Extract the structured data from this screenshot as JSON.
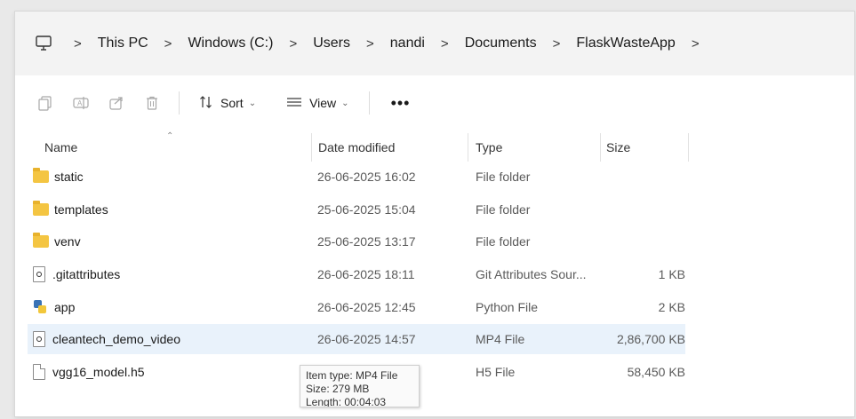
{
  "address_bar": {
    "icon": "computer-icon",
    "crumbs": [
      "This PC",
      "Windows (C:)",
      "Users",
      "nandi",
      "Documents",
      "FlaskWasteApp"
    ]
  },
  "toolbar": {
    "icons": [
      "copy-icon",
      "rename-icon",
      "share-icon",
      "delete-icon"
    ],
    "sort_label": "Sort",
    "view_label": "View",
    "more_label": "•••"
  },
  "columns": {
    "name": "Name",
    "date": "Date modified",
    "type": "Type",
    "size": "Size"
  },
  "files": [
    {
      "name": "static",
      "date": "26-06-2025 16:02",
      "type": "File folder",
      "size": "",
      "icon": "folder-icon"
    },
    {
      "name": "templates",
      "date": "25-06-2025 15:04",
      "type": "File folder",
      "size": "",
      "icon": "folder-icon"
    },
    {
      "name": "venv",
      "date": "25-06-2025 13:17",
      "type": "File folder",
      "size": "",
      "icon": "folder-icon"
    },
    {
      "name": ".gitattributes",
      "date": "26-06-2025 18:11",
      "type": "Git Attributes Sour...",
      "size": "1 KB",
      "icon": "settings-file-icon"
    },
    {
      "name": "app",
      "date": "26-06-2025 12:45",
      "type": "Python File",
      "size": "2 KB",
      "icon": "python-file-icon"
    },
    {
      "name": "cleantech_demo_video",
      "date": "26-06-2025 14:57",
      "type": "MP4 File",
      "size": "2,86,700 KB",
      "icon": "video-file-icon",
      "selected": true
    },
    {
      "name": "vgg16_model.h5",
      "date": "",
      "type": "H5 File",
      "size": "58,450 KB",
      "icon": "file-icon"
    }
  ],
  "tooltip": {
    "line1": "Item type: MP4 File",
    "line2": "Size: 279 MB",
    "line3": "Length: 00:04:03"
  }
}
